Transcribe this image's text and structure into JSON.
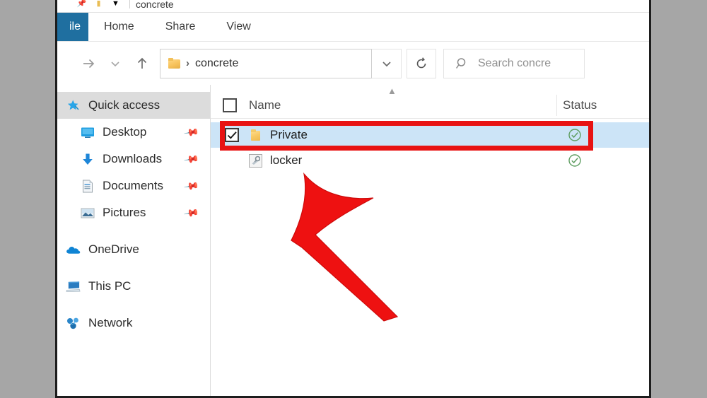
{
  "window": {
    "title": "concrete",
    "quick_access_toolbar": [
      "pin-icon",
      "folder-icon",
      "chevron-down-icon"
    ]
  },
  "ribbon": {
    "tabs": [
      {
        "label": "File",
        "visible_text": "ile",
        "active": true
      },
      {
        "label": "Home",
        "visible_text": "Home",
        "active": false
      },
      {
        "label": "Share",
        "visible_text": "Share",
        "active": false
      },
      {
        "label": "View",
        "visible_text": "View",
        "active": false
      }
    ]
  },
  "navbar": {
    "back_icon": "arrow-left-icon",
    "forward_icon": "arrow-right-icon",
    "recent_icon": "chevron-down-icon",
    "up_icon": "arrow-up-icon",
    "address": {
      "folder_icon": "folder-icon",
      "separator": "›",
      "path_text": "concrete",
      "dropdown_icon": "chevron-down-icon"
    },
    "refresh_icon": "refresh-icon",
    "search": {
      "icon": "search-icon",
      "placeholder": "Search concrete",
      "visible_text": "Search concre",
      "value": ""
    }
  },
  "navpane": {
    "items": [
      {
        "label": "Quick access",
        "icon": "star-pin-icon",
        "selected": true,
        "child": false,
        "pinned": false
      },
      {
        "label": "Desktop",
        "icon": "desktop-icon",
        "selected": false,
        "child": true,
        "pinned": true
      },
      {
        "label": "Downloads",
        "icon": "download-arrow-icon",
        "selected": false,
        "child": true,
        "pinned": true
      },
      {
        "label": "Documents",
        "icon": "document-icon",
        "selected": false,
        "child": true,
        "pinned": true
      },
      {
        "label": "Pictures",
        "icon": "picture-icon",
        "selected": false,
        "child": true,
        "pinned": true
      },
      {
        "label": "OneDrive",
        "icon": "cloud-icon",
        "selected": false,
        "child": false,
        "pinned": false
      },
      {
        "label": "This PC",
        "icon": "monitor-icon",
        "selected": false,
        "child": false,
        "pinned": false
      },
      {
        "label": "Network",
        "icon": "network-icon",
        "selected": false,
        "child": false,
        "pinned": false
      }
    ]
  },
  "filelist": {
    "sort_indicator": "chevron-up-icon",
    "columns": [
      {
        "key": "name",
        "label": "Name"
      },
      {
        "key": "status",
        "label": "Status"
      }
    ],
    "rows": [
      {
        "name": "Private",
        "type": "folder",
        "icon": "folder-icon",
        "checked": true,
        "selected": true,
        "status_icon": "green-check-circle-icon"
      },
      {
        "name": "locker",
        "type": "file",
        "icon": "script-file-icon",
        "checked": false,
        "selected": false,
        "status_icon": "green-check-circle-icon"
      }
    ]
  },
  "annotations": {
    "highlight_box": {
      "target": "Private",
      "color": "#e81313"
    },
    "arrow": {
      "direction": "up-left",
      "points_at": "Private",
      "color": "#ee1111"
    }
  },
  "colors": {
    "accent": "#1f6fa0",
    "selection": "#cce4f7",
    "annotation_red": "#e81313",
    "status_green": "#5f9e62",
    "page_background": "#a6a6a6"
  }
}
